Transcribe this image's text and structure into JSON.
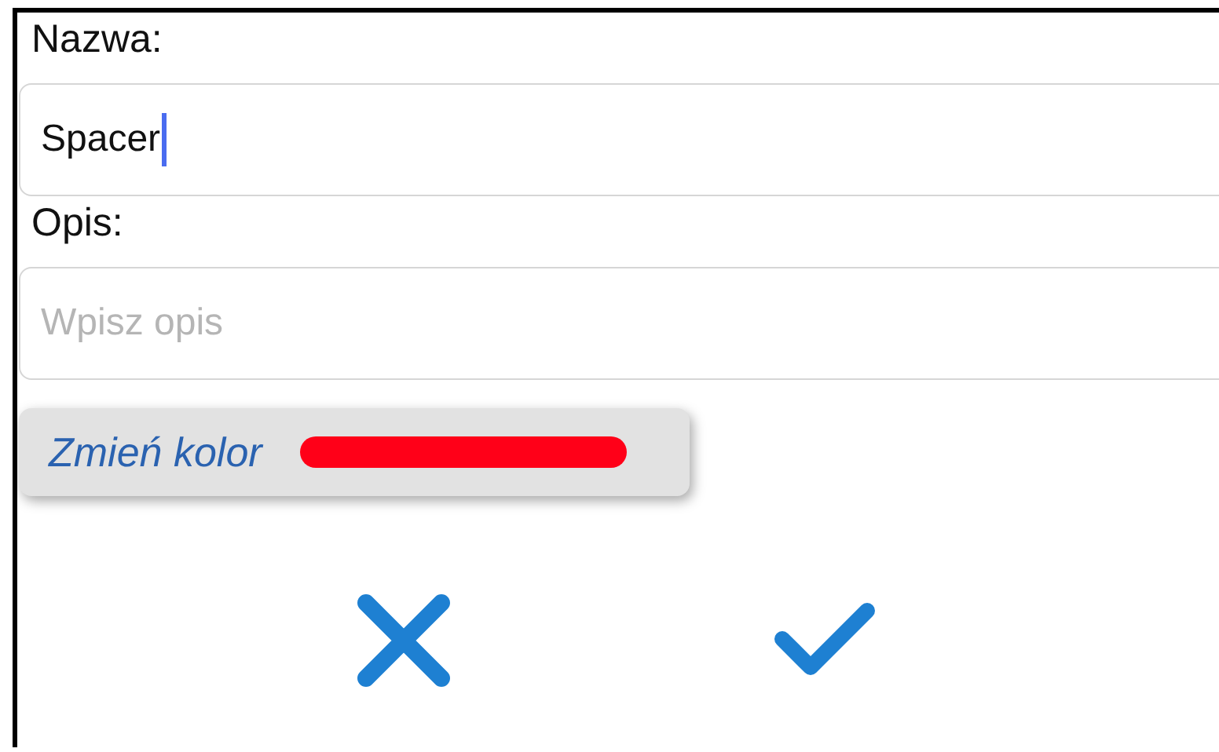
{
  "name_field": {
    "label": "Nazwa:",
    "value": "Spacer",
    "focused": true
  },
  "description_field": {
    "label": "Opis:",
    "placeholder": "Wpisz opis"
  },
  "color_button": {
    "label": "Zmień kolor",
    "color": "#ff0018"
  },
  "actions": [
    {
      "kind": "cancel"
    },
    {
      "kind": "confirm"
    }
  ]
}
